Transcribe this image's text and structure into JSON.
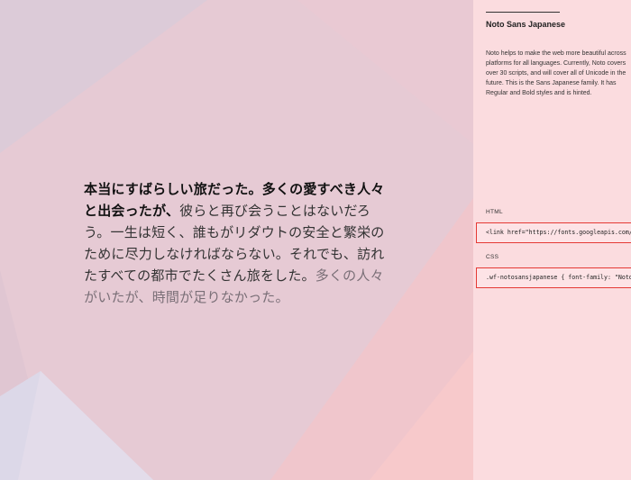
{
  "preview": {
    "sample_bold": "本当にすばらしい旅だった。多くの愛すべき人々と出会ったが、",
    "sample_regular": "彼らと再び会うことはないだろう。一生は短く、誰もがリダウトの安全と繁栄のために尽力しなければならない。それでも、訪れたすべての都市でたくさん旅をした。",
    "sample_light": "多くの人々がいたが、時間が足りなかった。"
  },
  "panel": {
    "font_name": "Noto Sans Japanese",
    "description": "Noto helps to make the web more beautiful across platforms for all languages. Currently, Noto covers over 30 scripts, and will cover all of Unicode in the future. This is the Sans Japanese family. It has Regular and Bold styles and is hinted.",
    "html_label": "HTML",
    "html_code": "<link href=\"https://fonts.googleapis.com/earlyaccess/notosansjapanese.css\" rel=\"stylesheet\">",
    "css_label": "CSS",
    "css_code": ".wf-notosansjapanese { font-family: \"Noto Sans Japanese\"; }"
  },
  "colors": {
    "preview_bg": "#e6cad4",
    "panel_bg": "#fbdcdf",
    "highlight_border": "#e53935"
  }
}
